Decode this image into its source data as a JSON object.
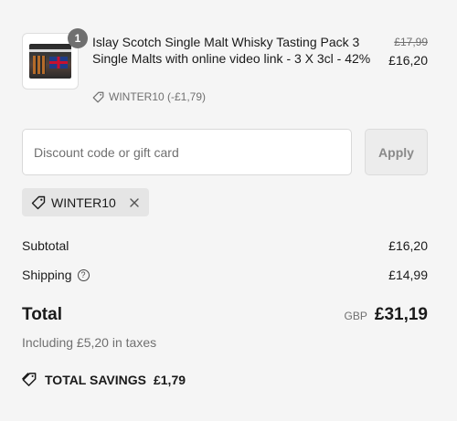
{
  "product": {
    "quantity": "1",
    "title": "Islay Scotch Single Malt Whisky Tasting Pack 3 Single Malts with online video link - 3 X 3cl - 42%",
    "original_price": "£17,99",
    "price": "£16,20",
    "discount_text": "WINTER10 (-£1,79)",
    "image_icon": "whisky-pack-box-image"
  },
  "discount": {
    "placeholder": "Discount code or gift card",
    "value": "",
    "apply_label": "Apply"
  },
  "applied_code": {
    "code": "WINTER10",
    "tag_icon": "tag-icon",
    "remove_icon": "close-icon"
  },
  "summary": {
    "subtotal_label": "Subtotal",
    "subtotal_value": "£16,20",
    "shipping_label": "Shipping",
    "shipping_help_icon": "question-circle-icon",
    "shipping_value": "£14,99",
    "total_label": "Total",
    "currency": "GBP",
    "total_value": "£31,19",
    "taxes_text": "Including £5,20 in taxes",
    "savings_label": "TOTAL SAVINGS",
    "savings_value": "£1,79",
    "savings_icon": "tags-icon"
  },
  "colors": {
    "background": "#f5f5f5",
    "text_primary": "#1a1a1a",
    "text_secondary": "#707070",
    "badge": "#6f6f6f",
    "chip": "#e5e5e5"
  }
}
